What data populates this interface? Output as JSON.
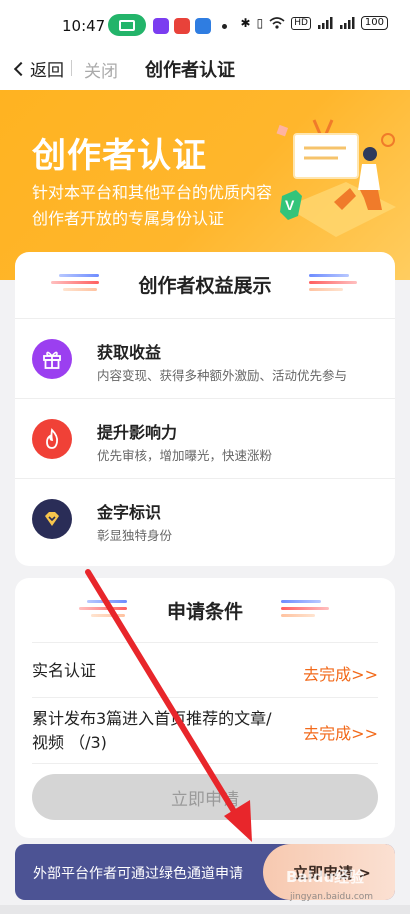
{
  "status_bar": {
    "time": "10:47",
    "badge_colors": [
      "#7b3df0",
      "#e8423a",
      "#2f7de1"
    ],
    "icons": [
      "bluetooth-icon",
      "vibrate-icon",
      "wifi-icon",
      "hd-icon",
      "signal-icon",
      "signal-icon",
      "battery-icon"
    ],
    "hd_label": "HD",
    "battery": "100"
  },
  "nav": {
    "back_label": "返回",
    "close_label": "关闭",
    "title": "创作者认证"
  },
  "hero": {
    "title": "创作者认证",
    "subtitle": "针对本平台和其他平台的优质内容创作者开放的专属身份认证"
  },
  "benefits": {
    "title": "创作者权益展示",
    "items": [
      {
        "icon": "gift-icon",
        "color": "#9b3ff0",
        "title": "获取收益",
        "desc": "内容变现、获得多种额外激励、活动优先参与"
      },
      {
        "icon": "flame-icon",
        "color": "#f04137",
        "title": "提升影响力",
        "desc": "优先审核，增加曝光，快速涨粉"
      },
      {
        "icon": "diamond-icon",
        "color": "#2a2d57",
        "title": "金字标识",
        "desc": "彰显独特身份"
      }
    ]
  },
  "conditions": {
    "title": "申请条件",
    "rows": [
      {
        "label": "实名认证",
        "action": "去完成>>"
      },
      {
        "label": "累计发布3篇进入首页推荐的文章/视频 （/3)",
        "action": "去完成>>"
      }
    ],
    "apply_label": "立即申请"
  },
  "banner": {
    "text": "外部平台作者可通过绿色通道申请",
    "button_label": "立即申请 >"
  },
  "watermark": {
    "text": "Baidu经验",
    "sub": "jingyan.baidu.com"
  },
  "colors": {
    "accent_orange": "#f26a1b",
    "hero_yellow": "#ffb321",
    "annotation_arrow": "#e8262b"
  }
}
